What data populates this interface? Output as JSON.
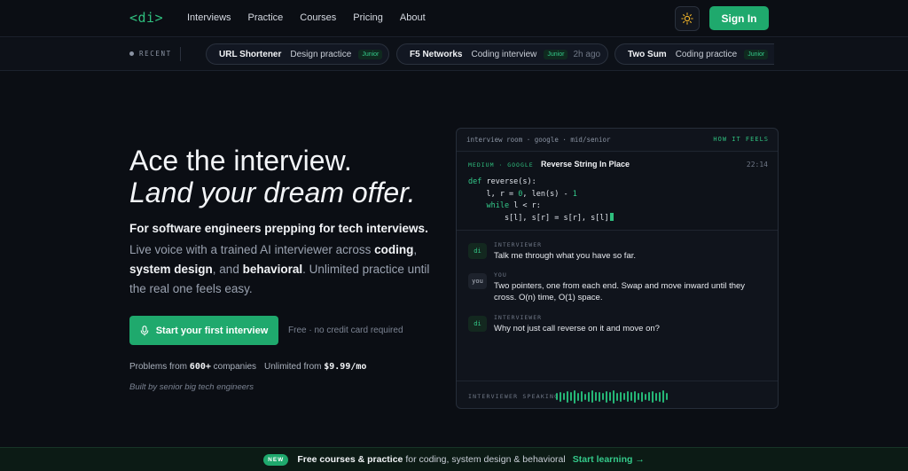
{
  "nav": {
    "logo": "<di>",
    "links": [
      "Interviews",
      "Practice",
      "Courses",
      "Pricing",
      "About"
    ],
    "signin": "Sign In"
  },
  "recent": {
    "label": "RECENT",
    "items": [
      {
        "title": "URL Shortener",
        "kind": "Design practice",
        "level": "Junior",
        "ago": ""
      },
      {
        "title": "F5 Networks",
        "kind": "Coding interview",
        "level": "Junior",
        "ago": "2h ago"
      },
      {
        "title": "Two Sum",
        "kind": "Coding practice",
        "level": "Junior",
        "ago": ""
      }
    ]
  },
  "hero": {
    "title_line1": "Ace the interview.",
    "title_line2": "Land your dream offer.",
    "lead_bold": "For software engineers prepping for tech interviews.",
    "lead_part1": "Live voice with a trained AI interviewer across ",
    "lead_coding": "coding",
    "lead_comma": ",",
    "lead_sysdesign": "system design",
    "lead_and": ", and ",
    "lead_behavioral": "behavioral",
    "lead_part2": ". Unlimited practice until the real one feels easy.",
    "cta": "Start your first interview",
    "cta_note": "Free · no credit card required",
    "stat1_prefix": "Problems from ",
    "stat1_num": "600+",
    "stat1_suffix": " companies",
    "stat2_prefix": "Unlimited from ",
    "stat2_num": "$9.99/mo",
    "built_by": "Built by senior big tech engineers"
  },
  "card": {
    "crumb": "interview room · google · mid/senior",
    "feels": "HOW IT FEELS",
    "meta": "MEDIUM · GOOGLE",
    "question": "Reverse String In Place",
    "time": "22:14",
    "messages": [
      {
        "who": "INTERVIEWER",
        "avatar": "di",
        "text": "Talk me through what you have so far."
      },
      {
        "who": "YOU",
        "avatar": "you",
        "text": "Two pointers, one from each end. Swap and move inward until they cross. O(n) time, O(1) space."
      },
      {
        "who": "INTERVIEWER",
        "avatar": "di",
        "text": "Why not just call reverse on it and move on?"
      }
    ],
    "speaking": "INTERVIEWER SPEAKING",
    "wave_levels": [
      0.35,
      0.6,
      0.4,
      0.8,
      0.5,
      0.9,
      0.45,
      0.7,
      0.3,
      0.6,
      0.85,
      0.5,
      0.65,
      0.4,
      0.75,
      0.55,
      0.9,
      0.45,
      0.6,
      0.35,
      0.7,
      0.5,
      0.8,
      0.4,
      0.65,
      0.3,
      0.55,
      0.75,
      0.45,
      0.6,
      0.85,
      0.4
    ]
  },
  "banner": {
    "badge": "NEW",
    "bold": "Free courses & practice",
    "text": "for coding, system design & behavioral",
    "link": "Start learning →"
  },
  "colors": {
    "accent": "#1fa96d",
    "bg": "#0b0e14"
  }
}
